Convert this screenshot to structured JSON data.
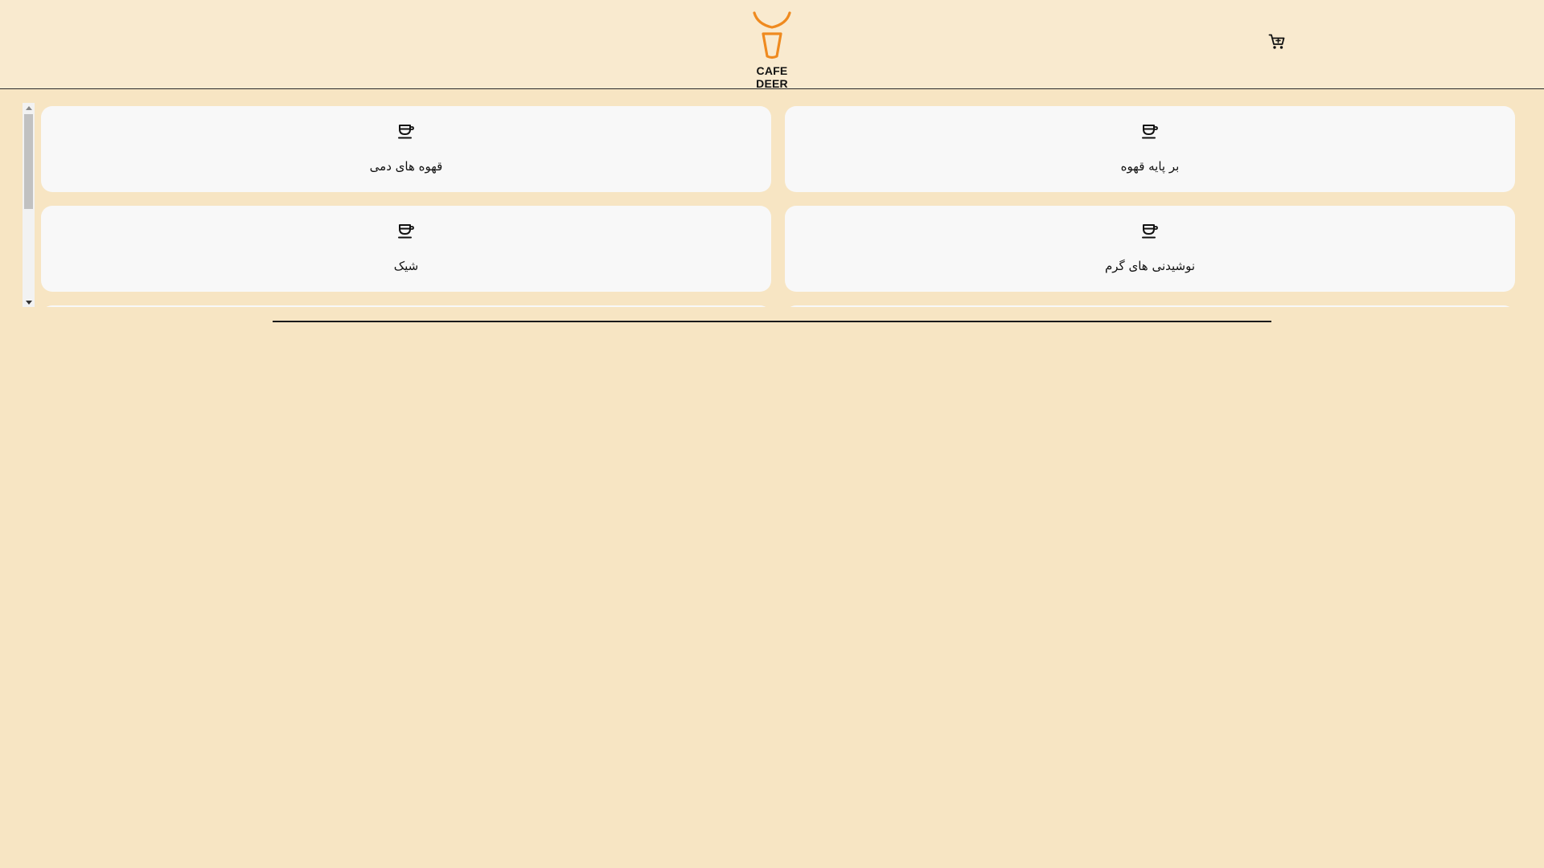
{
  "header": {
    "brand_name": "CAFE DEER",
    "logo_icon": "deer-cup-logo-icon",
    "cart_icon": "shopping-cart-icon"
  },
  "categories": [
    {
      "label": "بر پایه قهوه",
      "icon": "coffee-cup-icon"
    },
    {
      "label": "قهوه های دمی",
      "icon": "coffee-cup-icon"
    },
    {
      "label": "نوشیدنی های گرم",
      "icon": "coffee-cup-icon"
    },
    {
      "label": "شیک",
      "icon": "coffee-cup-icon"
    }
  ],
  "colors": {
    "page_background": "#f7e5c3",
    "header_background": "#f9eacf",
    "card_background": "#f8f8f8",
    "logo_accent": "#ef8a1f"
  }
}
